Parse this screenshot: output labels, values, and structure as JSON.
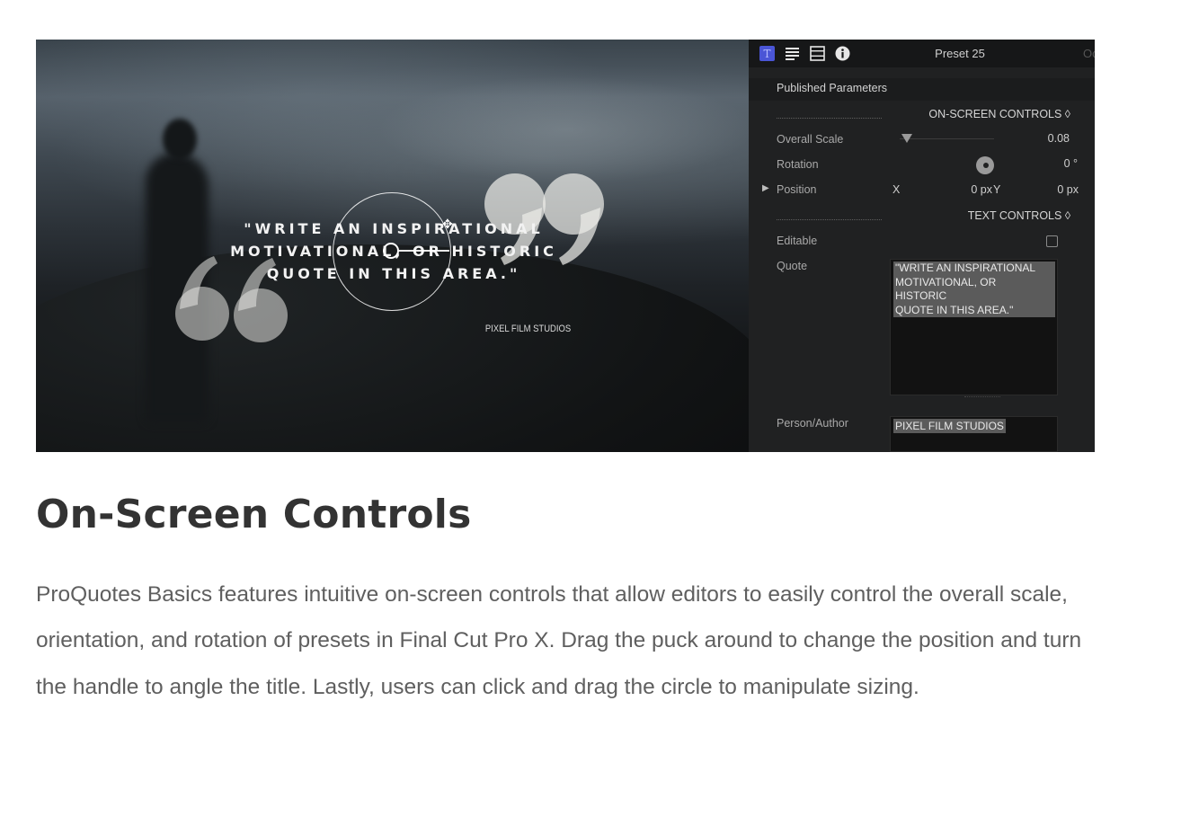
{
  "viewer": {
    "quote_lines": [
      "\"WRITE AN INSPIRATIONAL",
      "MOTIVATIONAL, OR HISTORIC",
      "QUOTE IN THIS AREA.\""
    ],
    "author": "PIXEL FILM STUDIOS"
  },
  "inspector": {
    "tab_icons": [
      "title-inspector-icon",
      "text-inspector-icon",
      "video-inspector-icon",
      "info-icon"
    ],
    "active_tab_color": "#4a55d6",
    "title": "Preset 25",
    "edge_fragment": "Oc",
    "published_parameters": "Published Parameters",
    "onscreen_section": "ON-SCREEN CONTROLS ◊",
    "overall_scale": {
      "label": "Overall Scale",
      "value": "0.08",
      "level": 0.08
    },
    "rotation": {
      "label": "Rotation",
      "value": "0 °"
    },
    "position": {
      "label": "Position",
      "x_label": "X",
      "x_value": "0 px",
      "y_label": "Y",
      "y_value": "0 px"
    },
    "text_section": "TEXT CONTROLS ◊",
    "editable": {
      "label": "Editable",
      "checked": false
    },
    "quote": {
      "label": "Quote",
      "value": "\"WRITE AN INSPIRATIONAL\nMOTIVATIONAL, OR\nHISTORIC\nQUOTE IN THIS AREA.\""
    },
    "author": {
      "label": "Person/Author",
      "value": "PIXEL FILM STUDIOS"
    }
  },
  "article": {
    "heading": "On-Screen Controls",
    "body": "ProQuotes Basics features intuitive on-screen controls that allow editors to easily control the overall scale, orientation, and rotation of presets in Final Cut Pro X.  Drag the puck around to change the position and turn the handle to angle the title.  Lastly, users can click and drag the circle to manipulate sizing."
  }
}
